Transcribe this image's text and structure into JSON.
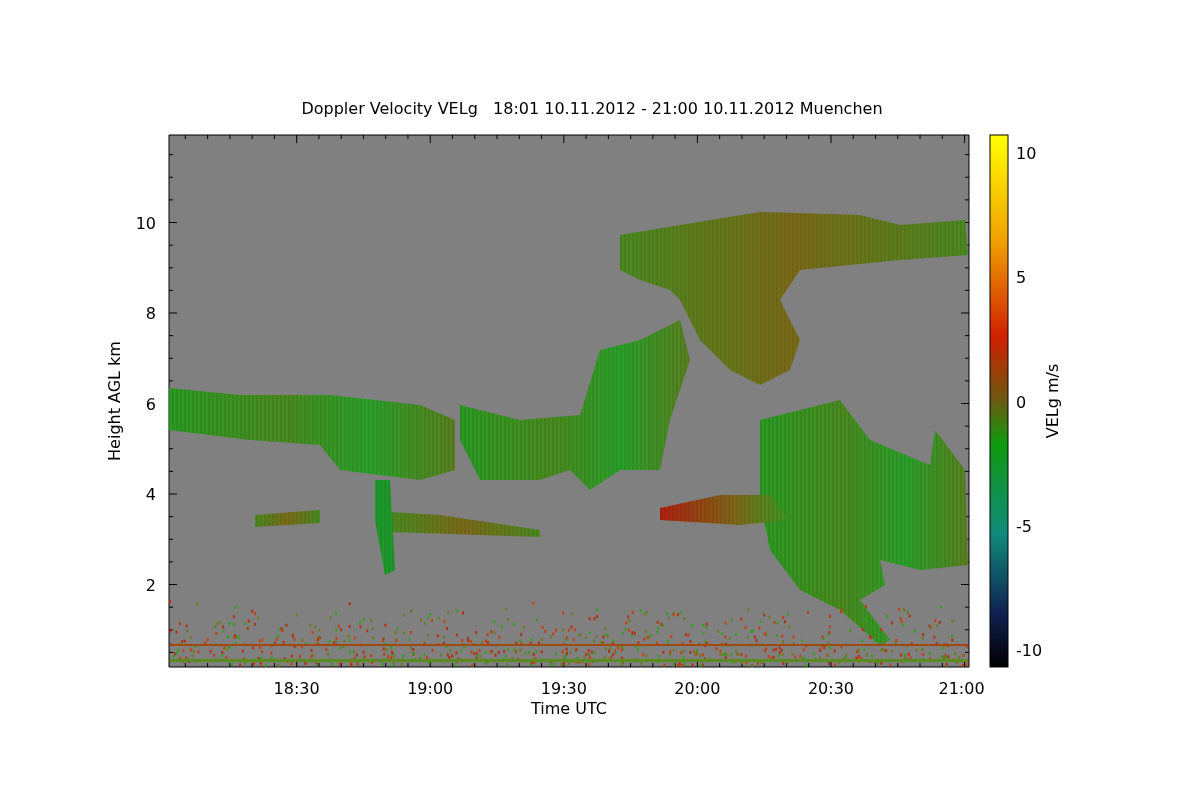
{
  "title": "Doppler Velocity VELg   18:01 10.11.2012 - 21:00 10.11.2012 Muenchen",
  "plot": {
    "ylabel": "Height AGL km",
    "xlabel": "Time UTC",
    "yticks": [
      "10",
      "8",
      "6",
      "4",
      "2"
    ],
    "xticks": [
      "18:30",
      "19:00",
      "19:30",
      "20:00",
      "20:30",
      "21:00"
    ]
  },
  "colorbar": {
    "label": "VELg m/s",
    "ticks": [
      "10",
      "5",
      "0",
      "-5",
      "-10"
    ]
  }
}
